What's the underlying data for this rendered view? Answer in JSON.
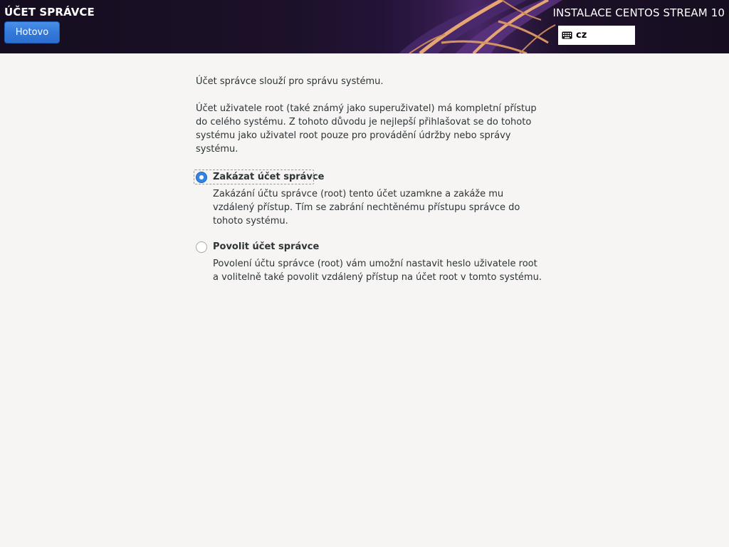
{
  "header": {
    "page_title": "ÚČET SPRÁVCE",
    "done_label": "Hotovo",
    "product_title": "INSTALACE CENTOS STREAM 10",
    "keyboard_layout": "cz",
    "keyboard_icon": "keyboard-icon"
  },
  "main": {
    "intro": "Účet správce slouží pro správu systému.",
    "description": "Účet uživatele root (také známý jako superuživatel) má kompletní přístup do celého systému. Z tohoto důvodu je nejlepší přihlašovat se do tohoto systému jako uživatel root pouze pro provádění údržby nebo správy systému.",
    "options": [
      {
        "label": "Zakázat účet správce",
        "description": "Zakázání účtu správce (root) tento účet uzamkne a zakáže mu vzdálený přístup. Tím se zabrání nechtěnému přístupu správce do tohoto systému.",
        "selected": true
      },
      {
        "label": "Povolit účet správce",
        "description": "Povolení účtu správce (root) vám umožní nastavit heslo uživatele root a volitelně také povolit vzdálený přístup na účet root v tomto systému.",
        "selected": false
      }
    ]
  },
  "colors": {
    "accent": "#3584e4",
    "header_bg": "#1c1129",
    "page_bg": "#f6f5f4"
  }
}
